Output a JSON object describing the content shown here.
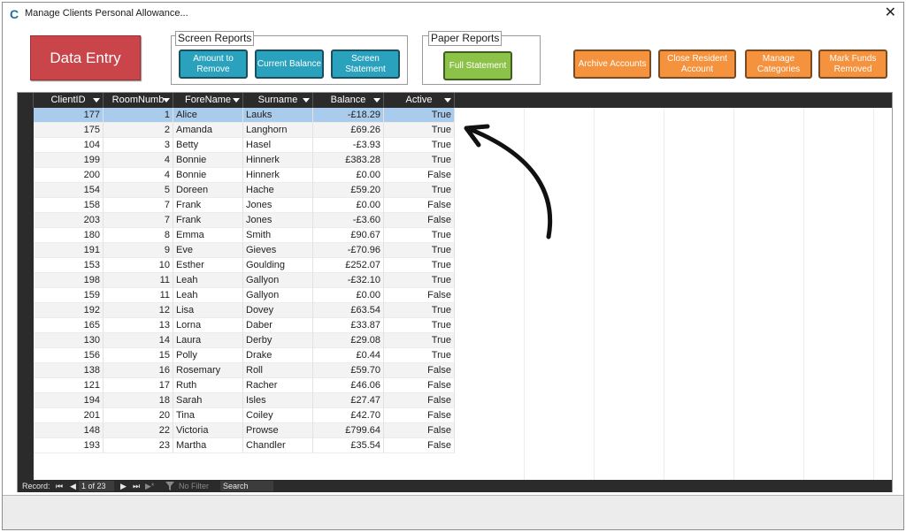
{
  "window": {
    "title": "Manage Clients Personal Allowance...",
    "close_glyph": "✕",
    "app_glyph": "C"
  },
  "buttons": {
    "data_entry": "Data Entry",
    "amount_to_remove": "Amount to Remove",
    "current_balance": "Current Balance",
    "screen_statement": "Screen Statement",
    "full_statement": "Full Statement",
    "archive_accounts": "Archive Accounts",
    "close_resident_account": "Close Resident Account",
    "manage_categories": "Manage Categories",
    "mark_funds_removed": "Mark Funds Removed"
  },
  "groups": {
    "screen_reports": "Screen Reports",
    "paper_reports": "Paper Reports"
  },
  "colors": {
    "data_entry": "#c9454a",
    "teal": "#2aa1bd",
    "green": "#8dc249",
    "orange": "#f5923e",
    "header": "#2b2b2b",
    "selected_row": "#a9cbec"
  },
  "table": {
    "columns": [
      "ClientID",
      "RoomNumb",
      "ForeName",
      "Surname",
      "Balance",
      "Active"
    ],
    "rows": [
      [
        "177",
        "1",
        "Alice",
        "Lauks",
        "-£18.29",
        "True"
      ],
      [
        "175",
        "2",
        "Amanda",
        "Langhorn",
        "£69.26",
        "True"
      ],
      [
        "104",
        "3",
        "Betty",
        "Hasel",
        "-£3.93",
        "True"
      ],
      [
        "199",
        "4",
        "Bonnie",
        "Hinnerk",
        "£383.28",
        "True"
      ],
      [
        "200",
        "4",
        "Bonnie",
        "Hinnerk",
        "£0.00",
        "False"
      ],
      [
        "154",
        "5",
        "Doreen",
        "Hache",
        "£59.20",
        "True"
      ],
      [
        "158",
        "7",
        "Frank",
        "Jones",
        "£0.00",
        "False"
      ],
      [
        "203",
        "7",
        "Frank",
        "Jones",
        "-£3.60",
        "False"
      ],
      [
        "180",
        "8",
        "Emma",
        "Smith",
        "£90.67",
        "True"
      ],
      [
        "191",
        "9",
        "Eve",
        "Gieves",
        "-£70.96",
        "True"
      ],
      [
        "153",
        "10",
        "Esther",
        "Goulding",
        "£252.07",
        "True"
      ],
      [
        "198",
        "11",
        "Leah",
        "Gallyon",
        "-£32.10",
        "True"
      ],
      [
        "159",
        "11",
        "Leah",
        "Gallyon",
        "£0.00",
        "False"
      ],
      [
        "192",
        "12",
        "Lisa",
        "Dovey",
        "£63.54",
        "True"
      ],
      [
        "165",
        "13",
        "Lorna",
        "Daber",
        "£33.87",
        "True"
      ],
      [
        "130",
        "14",
        "Laura",
        "Derby",
        "£29.08",
        "True"
      ],
      [
        "156",
        "15",
        "Polly",
        "Drake",
        "£0.44",
        "True"
      ],
      [
        "138",
        "16",
        "Rosemary",
        "Roll",
        "£59.70",
        "False"
      ],
      [
        "121",
        "17",
        "Ruth",
        "Racher",
        "£46.06",
        "False"
      ],
      [
        "194",
        "18",
        "Sarah",
        "Isles",
        "£27.47",
        "False"
      ],
      [
        "201",
        "20",
        "Tina",
        "Coiley",
        "£42.70",
        "False"
      ],
      [
        "148",
        "22",
        "Victoria",
        "Prowse",
        "£799.64",
        "False"
      ],
      [
        "193",
        "23",
        "Martha",
        "Chandler",
        "£35.54",
        "False"
      ]
    ],
    "selected_row_index": 0
  },
  "navigation": {
    "record_label": "Record:",
    "first_glyph": "⏮",
    "prev_glyph": "◀",
    "position": "1 of 23",
    "next_glyph": "▶",
    "last_glyph": "⏭",
    "new_glyph": "▶*",
    "filter_status": "No Filter",
    "search_placeholder": "Search"
  }
}
